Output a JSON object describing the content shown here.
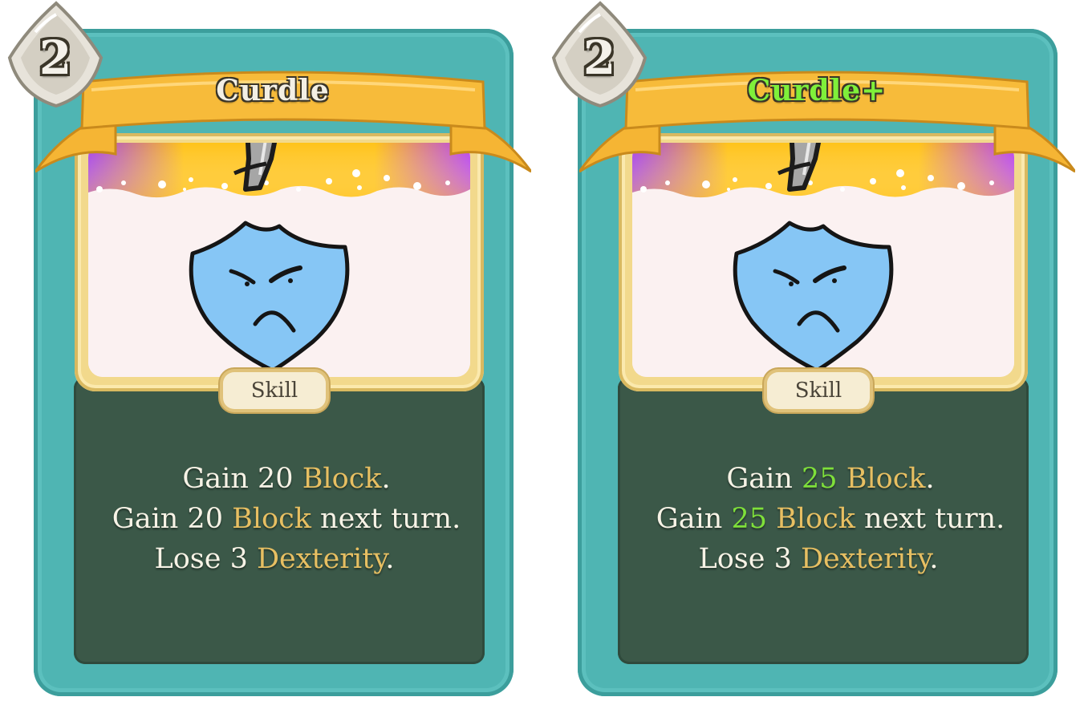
{
  "cards": [
    {
      "cost": "2",
      "title": "Curdle",
      "type": "Skill",
      "lines": [
        {
          "pre": "Gain 20 ",
          "keyword": "Block",
          "post": "."
        },
        {
          "pre": "Gain 20 ",
          "keyword": "Block",
          "post": " next turn."
        },
        {
          "pre": "Lose 3 ",
          "keyword": "Dexterity",
          "post": "."
        }
      ],
      "upgraded": false
    },
    {
      "cost": "2",
      "title": "Curdle+",
      "type": "Skill",
      "lines": [
        {
          "pre": "Gain ",
          "upgraded_value": "25",
          "keyword": "Block",
          "post": "."
        },
        {
          "pre": "Gain ",
          "upgraded_value": "25",
          "keyword": "Block",
          "post": " next turn."
        },
        {
          "pre": "Lose 3 ",
          "keyword": "Dexterity",
          "post": "."
        }
      ],
      "upgraded": true
    }
  ],
  "colors": {
    "card_teal": "#4fb5b3",
    "description_panel": "#3b5848",
    "banner_gold": "#f5b534",
    "keyword_gold": "#e7bf62",
    "upgrade_green": "#7fe03a",
    "shield_blue": "#86c6f5"
  },
  "icons": [
    "cost-energy-gem-icon",
    "sword-icon",
    "angry-shield-icon",
    "milk-splash-icon"
  ]
}
